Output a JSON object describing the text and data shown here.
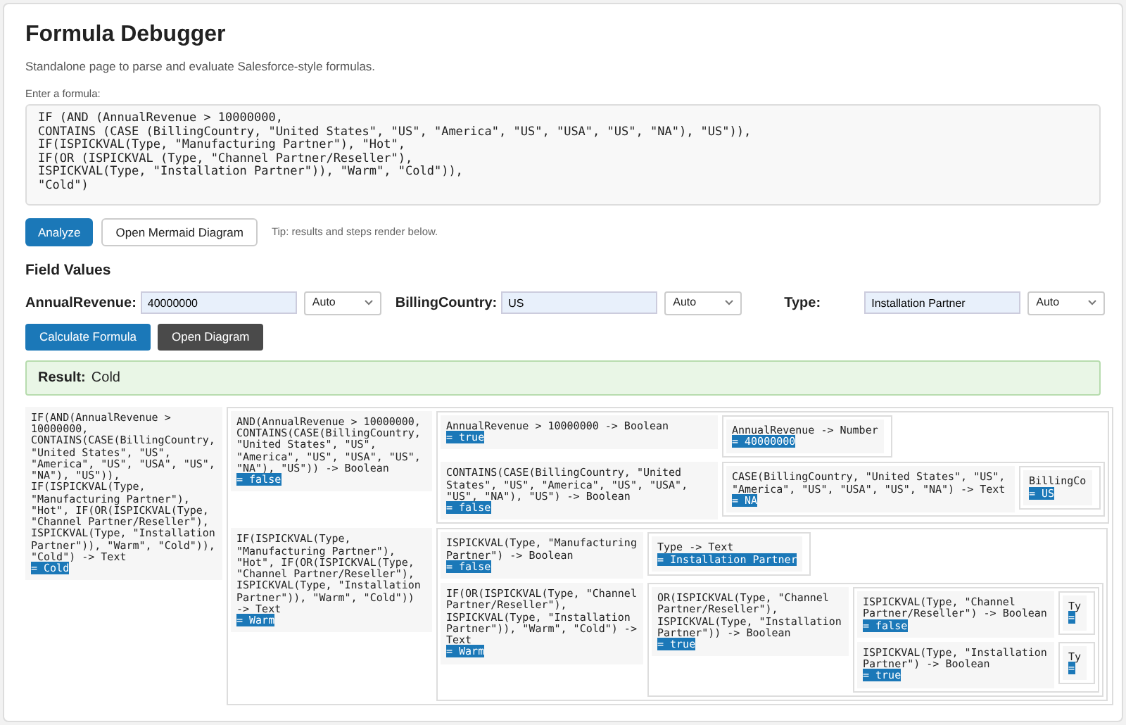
{
  "title": "Formula Debugger",
  "subtitle": "Standalone page to parse and evaluate Salesforce-style formulas.",
  "formula": {
    "label": "Enter a formula:",
    "value": "IF (AND (AnnualRevenue > 10000000,\nCONTAINS (CASE (BillingCountry, \"United States\", \"US\", \"America\", \"US\", \"USA\", \"US\", \"NA\"), \"US\")),\nIF(ISPICKVAL(Type, \"Manufacturing Partner\"), \"Hot\",\nIF(OR (ISPICKVAL (Type, \"Channel Partner/Reseller\"),\nISPICKVAL(Type, \"Installation Partner\")), \"Warm\", \"Cold\")),\n\"Cold\")"
  },
  "actions": [
    {
      "label": "Analyze",
      "kind": "primary"
    },
    {
      "label": "Open Mermaid Diagram",
      "kind": "outline"
    }
  ],
  "tip": "Tip: results and steps render below.",
  "field_values": {
    "heading": "Field Values",
    "fields": [
      {
        "label": "AnnualRevenue:",
        "value": "40000000",
        "type": "Auto"
      },
      {
        "label": "BillingCountry:",
        "value": "US",
        "type": "Auto"
      },
      {
        "label": "Type:",
        "value": "Installation Partner",
        "type": "Auto"
      }
    ]
  },
  "calc_buttons": [
    {
      "label": "Calculate Formula",
      "kind": "primary"
    },
    {
      "label": "Open Diagram",
      "kind": "dark"
    }
  ],
  "result": {
    "label": "Result:",
    "value": "Cold"
  },
  "tree": [
    {
      "expr": "IF(AND(AnnualRevenue > 10000000, CONTAINS(CASE(BillingCountry, \"United States\", \"US\", \"America\", \"US\", \"USA\", \"US\", \"NA\"), \"US\")), IF(ISPICKVAL(Type, \"Manufacturing Partner\"), \"Hot\", IF(OR(ISPICKVAL(Type, \"Channel Partner/Reseller\"), ISPICKVAL(Type, \"Installation Partner\")), \"Warm\", \"Cold\")), \"Cold\") -> Text",
      "result": "= Cold",
      "children": [
        {
          "expr": "AND(AnnualRevenue > 10000000, CONTAINS(CASE(BillingCountry, \"United States\", \"US\", \"America\", \"US\", \"USA\", \"US\", \"NA\"), \"US\")) -> Boolean",
          "result": "= false",
          "children": [
            {
              "expr": "AnnualRevenue > 10000000 -> Boolean",
              "result": "= true",
              "children": [
                {
                  "expr": "AnnualRevenue -> Number",
                  "result": "= 40000000"
                }
              ]
            },
            {
              "expr": "CONTAINS(CASE(BillingCountry, \"United States\", \"US\", \"America\", \"US\", \"USA\", \"US\", \"NA\"), \"US\") -> Boolean",
              "result": "= false",
              "children": [
                {
                  "expr": "CASE(BillingCountry, \"United States\", \"US\", \"America\", \"US\", \"USA\", \"US\", \"NA\") -> Text",
                  "result": "= NA",
                  "children": [
                    {
                      "expr": "BillingCo",
                      "result": "= US"
                    }
                  ]
                }
              ]
            }
          ]
        },
        {
          "expr": "IF(ISPICKVAL(Type, \"Manufacturing Partner\"), \"Hot\", IF(OR(ISPICKVAL(Type, \"Channel Partner/Reseller\"), ISPICKVAL(Type, \"Installation Partner\")), \"Warm\", \"Cold\")) -> Text",
          "result": "= Warm",
          "children": [
            {
              "expr": "ISPICKVAL(Type, \"Manufacturing Partner\") -> Boolean",
              "result": "= false",
              "children": [
                {
                  "expr": "Type -> Text",
                  "result": "= Installation Partner"
                }
              ]
            },
            {
              "expr": "IF(OR(ISPICKVAL(Type, \"Channel Partner/Reseller\"), ISPICKVAL(Type, \"Installation Partner\")), \"Warm\", \"Cold\") -> Text",
              "result": "= Warm",
              "children": [
                {
                  "expr": "OR(ISPICKVAL(Type, \"Channel Partner/Reseller\"), ISPICKVAL(Type, \"Installation Partner\")) -> Boolean",
                  "result": "= true",
                  "children": [
                    {
                      "expr": "ISPICKVAL(Type, \"Channel Partner/Reseller\") -> Boolean",
                      "result": "= false",
                      "children": [
                        {
                          "expr": "Ty",
                          "result": "="
                        }
                      ]
                    },
                    {
                      "expr": "ISPICKVAL(Type, \"Installation Partner\") -> Boolean",
                      "result": "= true",
                      "children": [
                        {
                          "expr": "Ty",
                          "result": "="
                        }
                      ]
                    }
                  ]
                }
              ]
            }
          ]
        }
      ]
    }
  ]
}
